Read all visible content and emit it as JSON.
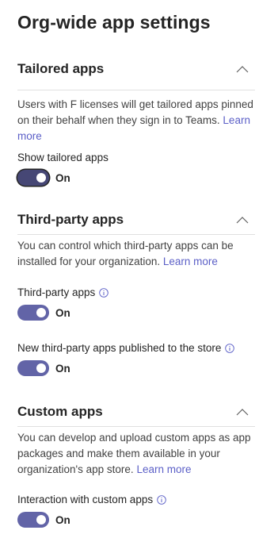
{
  "page_title": "Org-wide app settings",
  "colors": {
    "accent": "#6264a7",
    "accent_focused": "#464775",
    "link": "#5b5fc7",
    "divider": "#e0e0e0"
  },
  "sections": [
    {
      "title": "Tailored apps",
      "chevron_icon": "chevron-up-icon",
      "description": "Users with F licenses will get tailored apps pinned on their behalf when they sign in to Teams.",
      "link_text": "Learn more",
      "settings": [
        {
          "label": "Show tailored apps",
          "has_info": false,
          "state_text": "On",
          "on": true
        }
      ]
    },
    {
      "title": "Third-party apps",
      "chevron_icon": "chevron-up-icon",
      "description": "You can control which third-party apps can be installed for your organization.",
      "link_text": "Learn more",
      "settings": [
        {
          "label": "Third-party apps",
          "has_info": true,
          "state_text": "On",
          "on": true
        },
        {
          "label": "New third-party apps published to the store",
          "has_info": true,
          "state_text": "On",
          "on": true
        }
      ]
    },
    {
      "title": "Custom apps",
      "chevron_icon": "chevron-up-icon",
      "description": "You can develop and upload custom apps as app packages and make them available in your organization's app store.",
      "link_text": "Learn more",
      "settings": [
        {
          "label": "Interaction with custom apps",
          "has_info": true,
          "state_text": "On",
          "on": true
        }
      ]
    }
  ]
}
